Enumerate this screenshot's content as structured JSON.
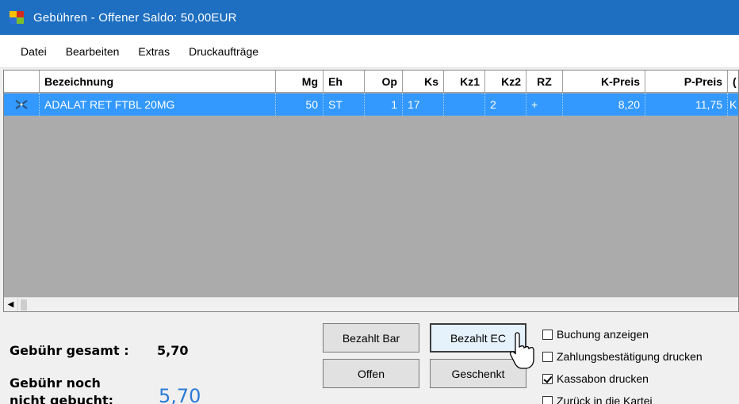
{
  "window": {
    "title": "Gebühren - Offener Saldo: 50,00EUR"
  },
  "menu": [
    "Datei",
    "Bearbeiten",
    "Extras",
    "Druckaufträge"
  ],
  "grid": {
    "columns": [
      "",
      "Bezeichnung",
      "Mg",
      "Eh",
      "Op",
      "Ks",
      "Kz1",
      "Kz2",
      "RZ",
      "K-Preis",
      "P-Preis",
      "("
    ],
    "rows": [
      {
        "bezeichnung": "ADALAT RET FTBL 20MG",
        "mg": "50",
        "eh": "ST",
        "op": "1",
        "ks": "17",
        "kz1": "",
        "kz2": "2",
        "rz": "+",
        "k_preis": "8,20",
        "p_preis": "11,75",
        "last": "K"
      }
    ]
  },
  "summary": {
    "gesamt_label": "Gebühr gesamt :",
    "gesamt_value": "5,70",
    "noch_label_1": "Gebühr noch",
    "noch_label_2": "nicht gebucht:",
    "noch_value": "5,70"
  },
  "buttons": {
    "bar": "Bezahlt Bar",
    "ec": "Bezahlt EC",
    "offen": "Offen",
    "geschenkt": "Geschenkt"
  },
  "options": [
    {
      "label": "Buchung anzeigen",
      "checked": false
    },
    {
      "label": "Zahlungsbestätigung drucken",
      "checked": false
    },
    {
      "label": "Kassabon drucken",
      "checked": true
    },
    {
      "label": "Zurück in die Kartei",
      "checked": false
    }
  ],
  "colors": {
    "titlebar": "#1e6fc1",
    "selection": "#3399ff",
    "grid_bg": "#ababab",
    "amount_blue": "#2b7bd6"
  }
}
